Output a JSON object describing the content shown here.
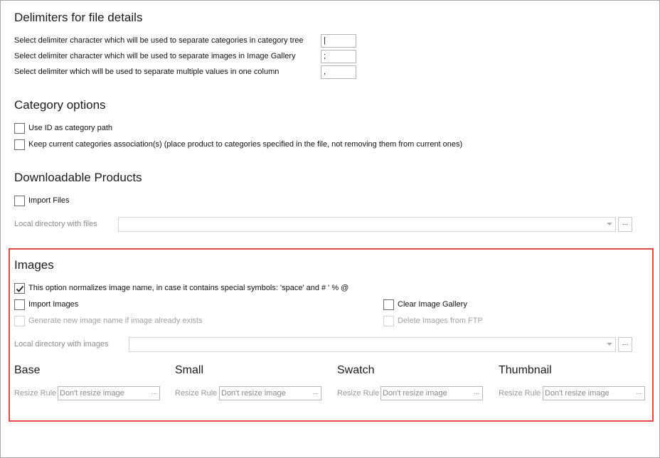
{
  "delimiters": {
    "title": "Delimiters for file details",
    "rows": [
      {
        "label": "Select delimiter character which will be used to separate categories in category tree",
        "value": "|"
      },
      {
        "label": "Select delimiter character which will be used to separate images in Image Gallery",
        "value": ";"
      },
      {
        "label": "Select delimiter which will be used to separate multiple values in one column",
        "value": ","
      }
    ]
  },
  "category_options": {
    "title": "Category options",
    "use_id_label": "Use ID as category path",
    "keep_assoc_label": "Keep current categories association(s) (place product to categories specified in the file, not removing them from current ones)"
  },
  "downloadable": {
    "title": "Downloadable Products",
    "import_files_label": "Import Files",
    "local_dir_label": "Local directory with files",
    "browse_label": "..."
  },
  "images": {
    "title": "Images",
    "normalize_label": "This option normalizes image name, in case it contains special symbols: 'space' and # ' % @",
    "normalize_checked": true,
    "import_images_label": "Import Images",
    "generate_name_label": "Generate new image name if image already exists",
    "clear_gallery_label": "Clear Image Gallery",
    "delete_ftp_label": "Delete Images from FTP",
    "local_dir_label": "Local directory with images",
    "browse_label": "...",
    "resize_sections": [
      {
        "title": "Base",
        "rule_label": "Resize Rule",
        "value": "Don't resize image"
      },
      {
        "title": "Small",
        "rule_label": "Resize Rule",
        "value": "Don't resize image"
      },
      {
        "title": "Swatch",
        "rule_label": "Resize Rule",
        "value": "Don't resize image"
      },
      {
        "title": "Thumbnail",
        "rule_label": "Resize Rule",
        "value": "Don't resize image"
      }
    ],
    "resize_btn": "..."
  },
  "colors": {
    "highlight_border": "#e0494a",
    "checkmark": "#222222"
  }
}
